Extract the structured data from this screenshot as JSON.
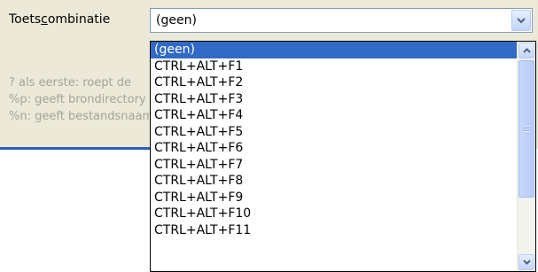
{
  "form": {
    "label_before": "Toets",
    "label_mnemonic": "c",
    "label_after": "ombinatie",
    "combo_value": "(geen)"
  },
  "hints": [
    "? als eerste: roept de",
    "%p: geeft brondirectory",
    "%n: geeft bestandsnaam"
  ],
  "dropdown": {
    "items": [
      "(geen)",
      "CTRL+ALT+F1",
      "CTRL+ALT+F2",
      "CTRL+ALT+F3",
      "CTRL+ALT+F4",
      "CTRL+ALT+F5",
      "CTRL+ALT+F6",
      "CTRL+ALT+F7",
      "CTRL+ALT+F8",
      "CTRL+ALT+F9",
      "CTRL+ALT+F10",
      "CTRL+ALT+F11"
    ],
    "selected_index": 0
  },
  "icons": {
    "combo_button": "chevron-down-icon",
    "scroll_up": "chevron-up-icon",
    "scroll_down": "chevron-down-icon"
  },
  "colors": {
    "selection": "#316ac5",
    "panel": "#ece9d8",
    "hint_text": "#a6a299",
    "accent_line": "#2b5cc2"
  }
}
